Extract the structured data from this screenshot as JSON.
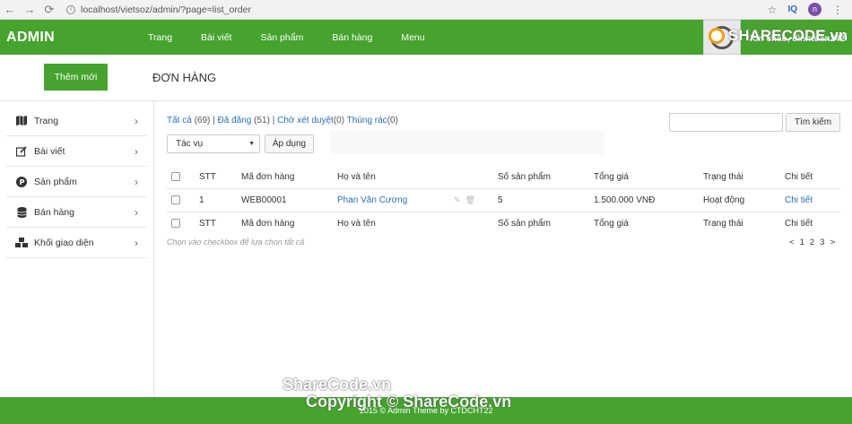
{
  "browser": {
    "back": "←",
    "forward": "→",
    "reload": "⟳",
    "url": "localhost/vietsoz/admin/?page=list_order",
    "profile_initial": "n",
    "ext_label": "IQ"
  },
  "header": {
    "brand": "ADMIN",
    "nav": [
      "Trang",
      "Bài viết",
      "Sản phẩm",
      "Bán hàng",
      "Menu"
    ],
    "greeting": "Xin chào, dinhtuan242",
    "logo_watermark": "SHARECODE.vn"
  },
  "subheader": {
    "add_button": "Thêm mới",
    "page_title": "ĐƠN HÀNG"
  },
  "sidebar": {
    "items": [
      {
        "label": "Trang",
        "icon": "map-icon"
      },
      {
        "label": "Bài viết",
        "icon": "edit-icon"
      },
      {
        "label": "Sản phẩm",
        "icon": "product-icon"
      },
      {
        "label": "Bán hàng",
        "icon": "database-icon"
      },
      {
        "label": "Khối giao diện",
        "icon": "blocks-icon"
      }
    ]
  },
  "filters": {
    "all": "Tất cả",
    "all_count": "(69)",
    "published": "Đã đăng",
    "published_count": "(51)",
    "pending": "Chờ xét duyệt",
    "pending_count": "(0)",
    "trash": "Thùng rác",
    "trash_count": "(0)",
    "sep": "|"
  },
  "search": {
    "button": "Tìm kiếm",
    "value": ""
  },
  "bulk": {
    "select_value": "Tác vụ",
    "apply": "Áp dụng"
  },
  "table": {
    "columns": [
      "STT",
      "Mã đơn hàng",
      "Họ và tên",
      "Số sản phẩm",
      "Tổng giá",
      "Trạng thái",
      "Chi tiết"
    ],
    "rows": [
      {
        "stt": "1",
        "code": "WEB00001",
        "name": "Phan Văn Cương",
        "qty": "5",
        "total": "1.500.000 VNĐ",
        "status": "Hoạt động",
        "detail": "Chi tiết"
      }
    ],
    "footer_columns": [
      "STT",
      "Mã đơn hàng",
      "Họ và tên",
      "Số sản phẩm",
      "Tổng giá",
      "Trạng thái",
      "Chi tiết"
    ]
  },
  "hint": "Chọn vào checkbox để lựa chọn tất cả",
  "pager": [
    "<",
    "1",
    "2",
    "3",
    ">"
  ],
  "footer": {
    "text": "2015 © Admin Theme by CTDCHT22"
  },
  "watermark": {
    "line1": "ShareCode.vn",
    "line2": "Copyright © ShareCode.vn"
  },
  "colors": {
    "brand_green": "#45a32e",
    "link_blue": "#2a6fb0"
  }
}
